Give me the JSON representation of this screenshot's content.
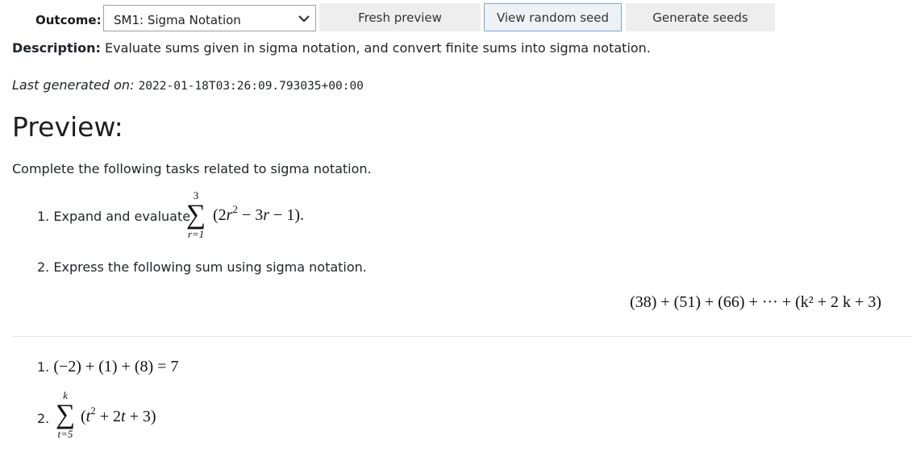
{
  "toolbar": {
    "outcome_label": "Outcome:",
    "outcome_selected": "SM1: Sigma Notation",
    "fresh_preview_label": "Fresh preview",
    "view_random_seed_label": "View random seed",
    "generate_seeds_label": "Generate seeds"
  },
  "description": {
    "label": "Description:",
    "text": "Evaluate sums given in sigma notation, and convert finite sums into sigma notation."
  },
  "last_generated": {
    "label": "Last generated on:",
    "value": "2022-01-18T03:26:09.793035+00:00"
  },
  "preview": {
    "heading": "Preview:",
    "intro": "Complete the following tasks related to sigma notation.",
    "task1": {
      "number": "1.",
      "text": "Expand and evaluate",
      "sigma_upper": "3",
      "sigma_lower": "r=1",
      "suffix": "."
    },
    "task2": {
      "number": "2.",
      "text": "Express the following sum using sigma notation.",
      "sum_display": "(38) + (51) + (66) + ··· + (k² + 2 k + 3)"
    }
  },
  "answers": {
    "answer1": {
      "number": "1.",
      "expression": "(−2) + (1) + (8) = 7"
    },
    "answer2": {
      "number": "2.",
      "sigma_upper": "k",
      "sigma_lower": "t=5"
    }
  }
}
